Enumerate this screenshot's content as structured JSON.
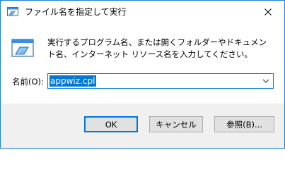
{
  "window": {
    "title": "ファイル名を指定して実行",
    "close_icon": "close-icon",
    "accent_color": "#0078d7"
  },
  "description": "実行するプログラム名、または開くフォルダーやドキュメント名、インターネット リソース名を入力してください。",
  "name_field": {
    "label": "名前(O):",
    "value": "appwiz.cpl"
  },
  "buttons": {
    "ok": "OK",
    "cancel": "キャンセル",
    "browse": "参照(B)..."
  }
}
